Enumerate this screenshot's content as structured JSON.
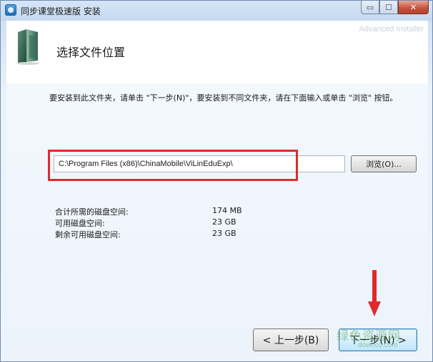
{
  "window": {
    "title": "同步课堂极速版 安装",
    "minimize_glyph": "▭",
    "maximize_glyph": "☐",
    "close_glyph": "✕"
  },
  "header": {
    "title": "选择文件位置",
    "brand": "Advanced Installer",
    "icon": "folder-icon"
  },
  "instructions": "要安装到此文件夹，请单击 \"下一步(N)\"，要安装到不同文件夹，请在下面输入或单击 \"浏览\" 按钮。",
  "path": {
    "value": "C:\\Program Files (x86)\\ChinaMobile\\ViLinEduExp\\"
  },
  "browse_label": "浏览(O)...",
  "space": [
    {
      "label": "合计所需的磁盘空间:",
      "value": "174 MB"
    },
    {
      "label": "可用磁盘空间:",
      "value": "23 GB"
    },
    {
      "label": "剩余可用磁盘空间:",
      "value": "23 GB"
    }
  ],
  "buttons": {
    "back": "< 上一步(B)",
    "next": "下一步(N) >"
  },
  "watermark": {
    "main": "绿色资源网",
    "sub": "downcc.com"
  },
  "colors": {
    "highlight": "#e02a2a",
    "arrow": "#e02a2a"
  }
}
